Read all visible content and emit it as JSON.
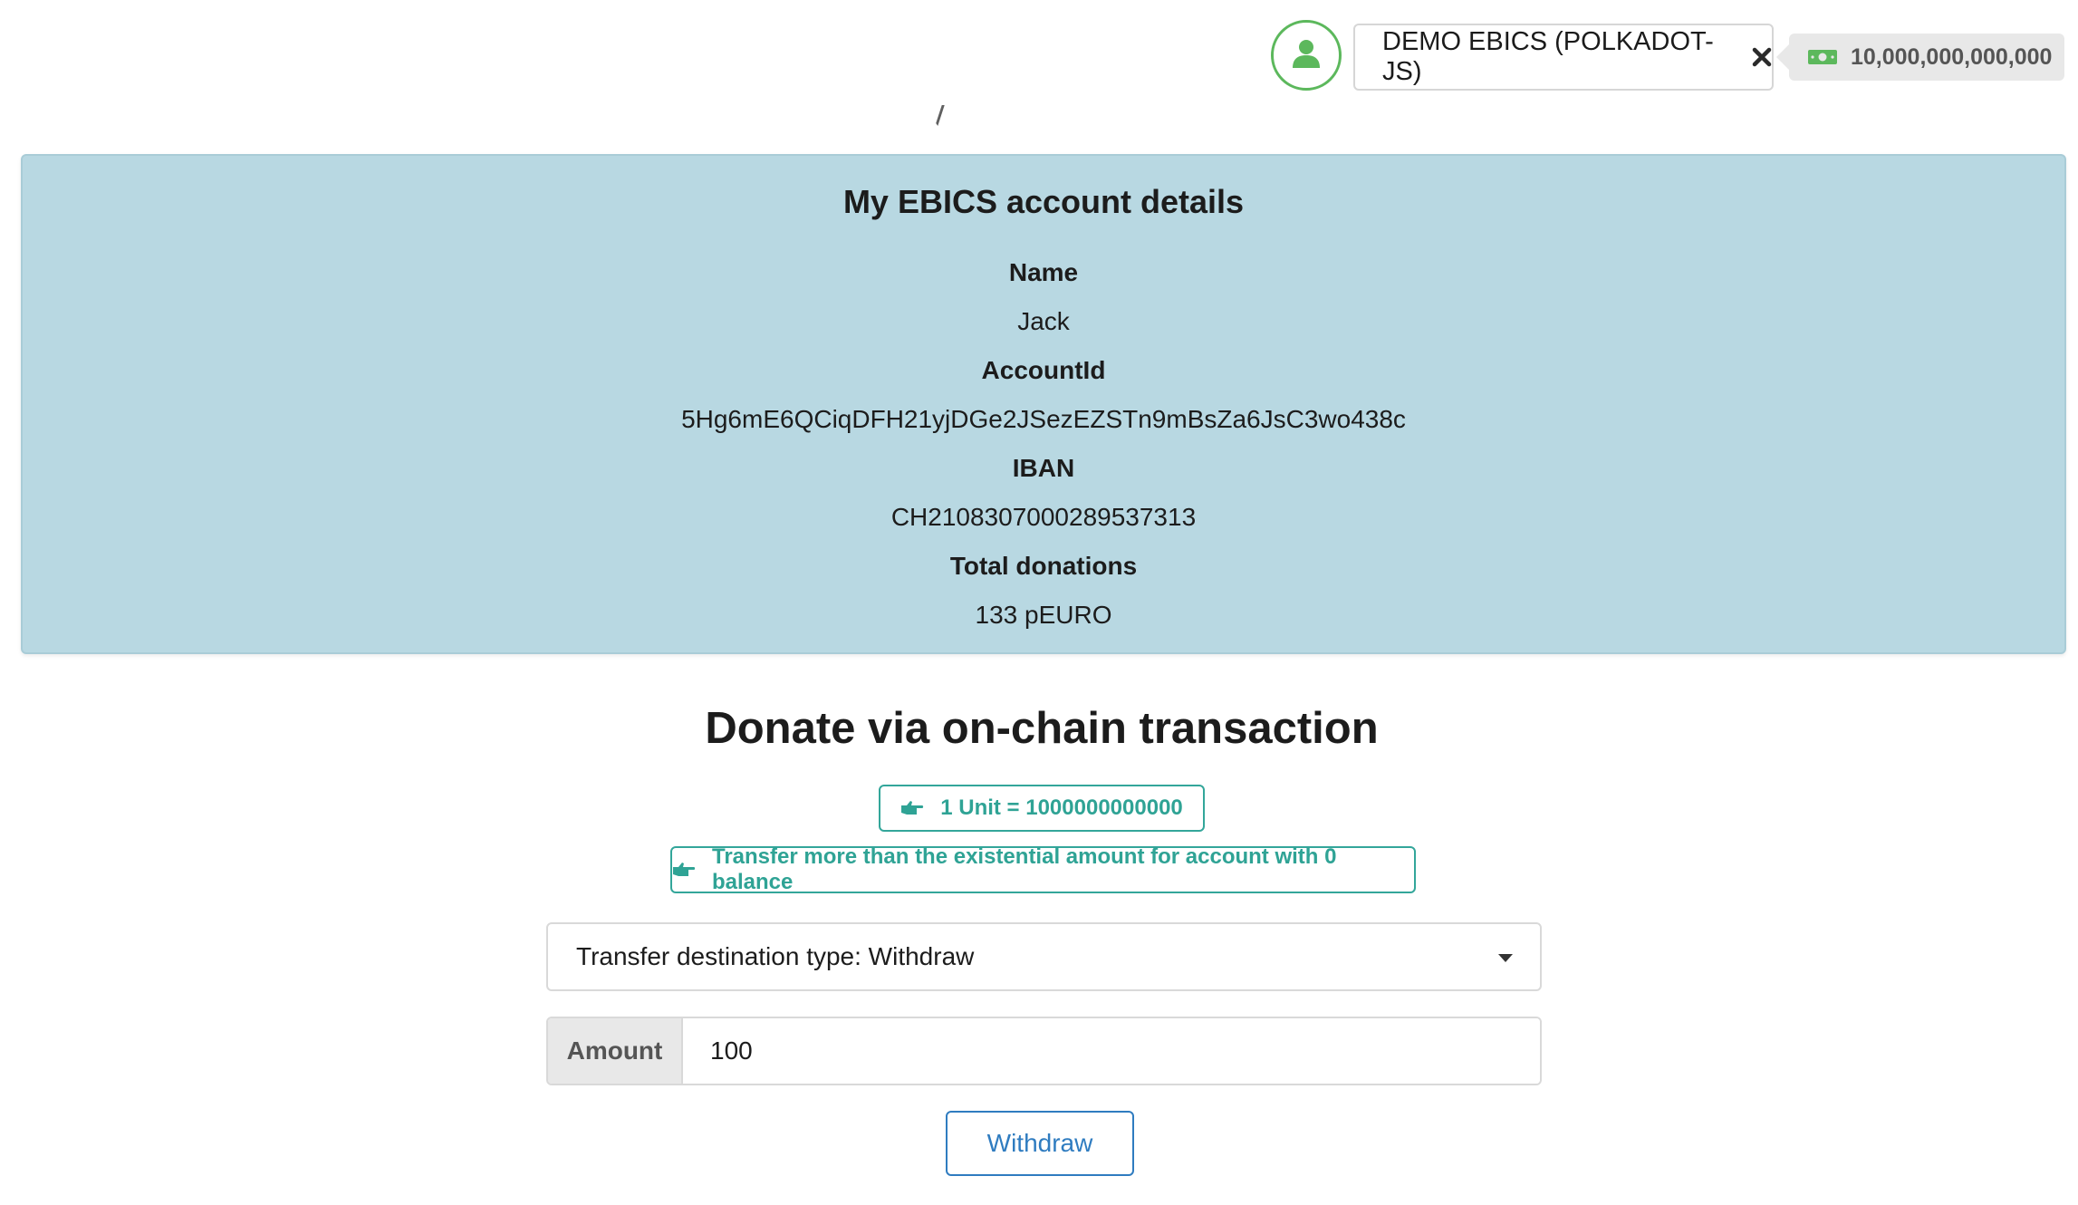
{
  "header": {
    "account_name": "DEMO EBICS (POLKADOT-JS)",
    "balance": "10,000,000,000,000",
    "icons": {
      "avatar": "user-icon",
      "close": "close-icon",
      "balance": "money-bill-icon"
    },
    "colors": {
      "avatar_ring": "#5cb85c",
      "money_icon": "#5cb85c"
    }
  },
  "details": {
    "title": "My EBICS account details",
    "fields": [
      {
        "label": "Name",
        "value": "Jack"
      },
      {
        "label": "AccountId",
        "value": "5Hg6mE6QCiqDFH21yjDGe2JSezEZSTn9mBsZa6JsC3wo438c"
      },
      {
        "label": "IBAN",
        "value": "CH2108307000289537313"
      },
      {
        "label": "Total donations",
        "value": "133 pEURO"
      }
    ],
    "colors": {
      "background": "#b8d8e2"
    }
  },
  "donate": {
    "title": "Donate via on-chain transaction",
    "tags": [
      {
        "text": "1 Unit = 1000000000000",
        "icon": "hand-point-right-icon"
      },
      {
        "text": "Transfer more than the existential amount for account with 0 balance",
        "icon": "hand-point-right-icon"
      }
    ],
    "destination_select": {
      "selected": "Transfer destination type: Withdraw",
      "icon": "caret-down-icon"
    },
    "amount": {
      "label": "Amount",
      "value": "100"
    },
    "submit_label": "Withdraw",
    "colors": {
      "tag_accent": "#2fa395",
      "button_accent": "#2f7cc0"
    }
  }
}
